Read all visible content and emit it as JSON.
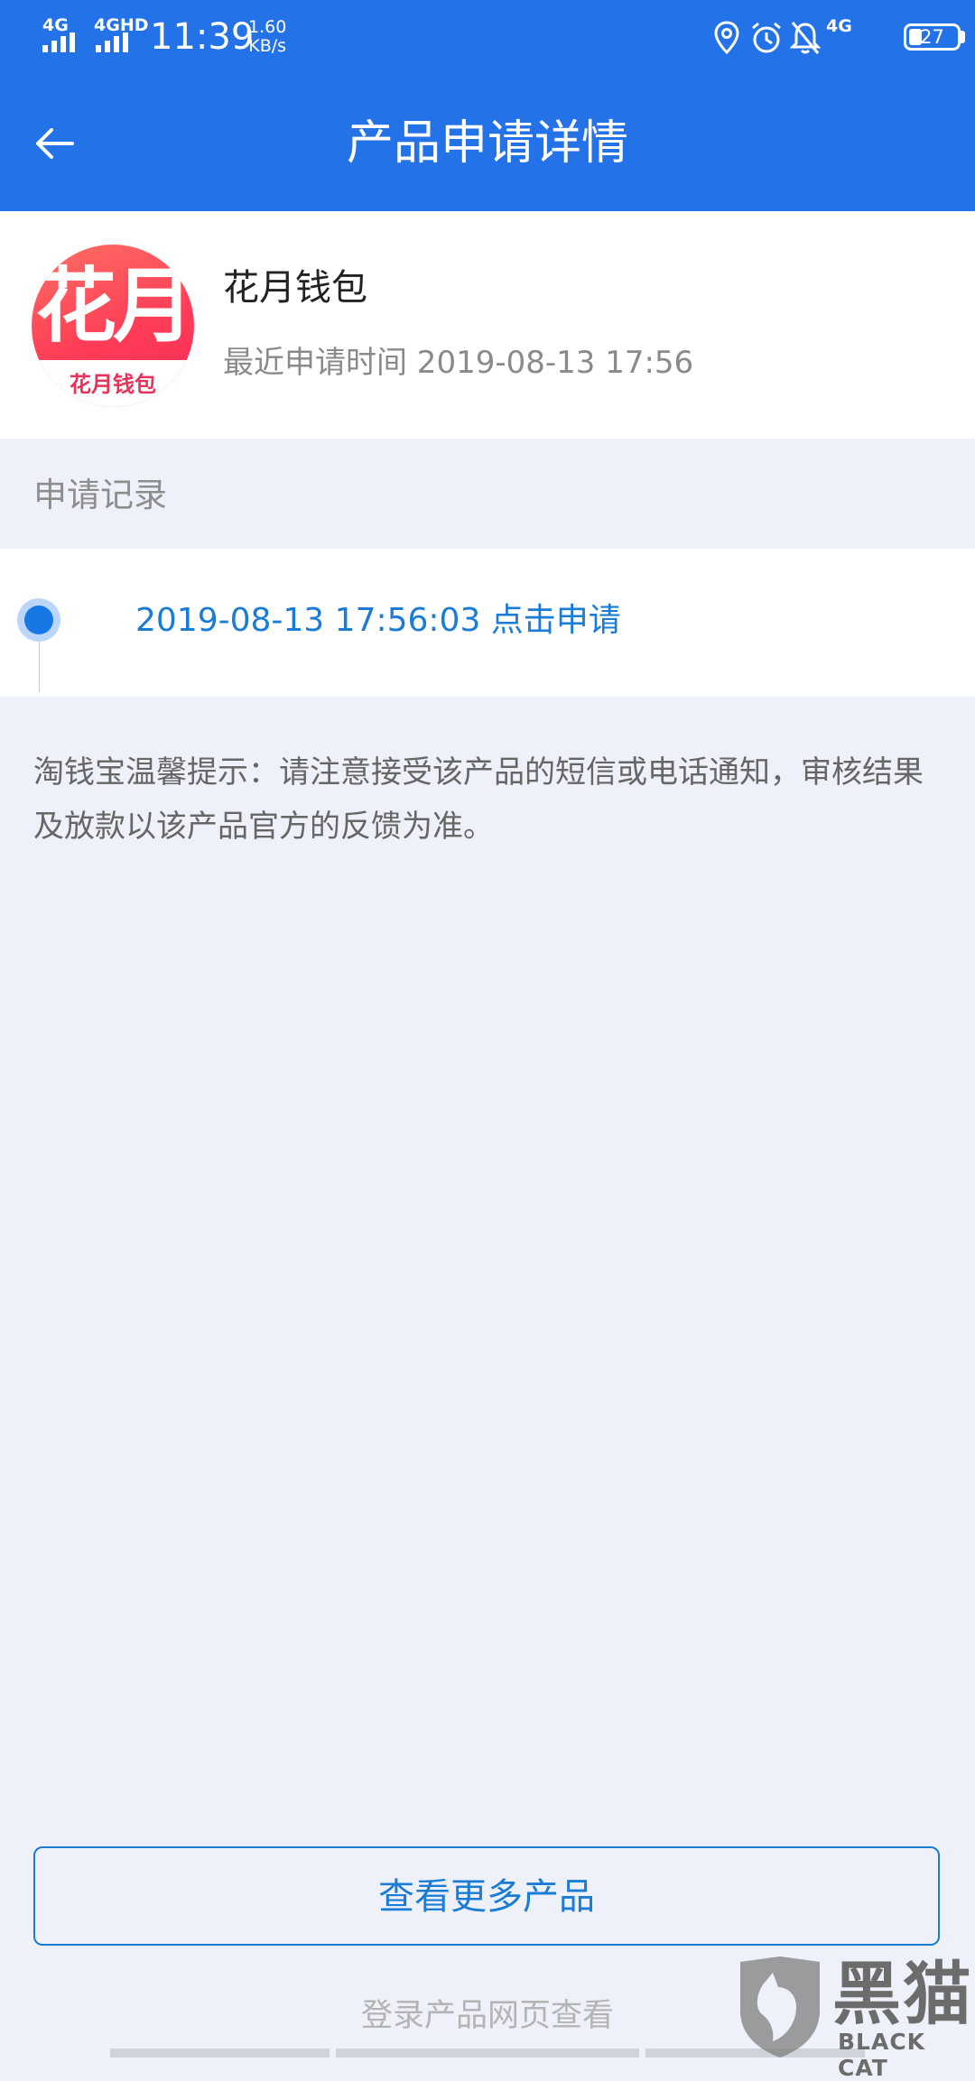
{
  "status_bar": {
    "network_1": "4G",
    "network_2": "4GHD",
    "time": "11:39",
    "speed_value": "1.60",
    "speed_unit": "KB/s",
    "network_3": "4G",
    "battery": "27",
    "battery_level_percent": 27
  },
  "header": {
    "title": "产品申请详情"
  },
  "product": {
    "logo_big": "花月",
    "logo_small": "花月钱包",
    "name": "花月钱包",
    "recent_time": "最近申请时间 2019-08-13 17:56"
  },
  "records": {
    "label": "申请记录",
    "items": [
      {
        "text": "2019-08-13 17:56:03 点击申请"
      }
    ]
  },
  "tip": "淘钱宝温馨提示：请注意接受该产品的短信或电话通知，审核结果及放款以该产品官方的反馈为准。",
  "footer": {
    "more_button": "查看更多产品",
    "login_link": "登录产品网页查看"
  },
  "watermark": {
    "text": "黑猫",
    "sub": "BLACK CAT"
  },
  "colors": {
    "primary": "#2472e8",
    "link": "#1a7cd5",
    "page_bg": "#eef1f9"
  }
}
